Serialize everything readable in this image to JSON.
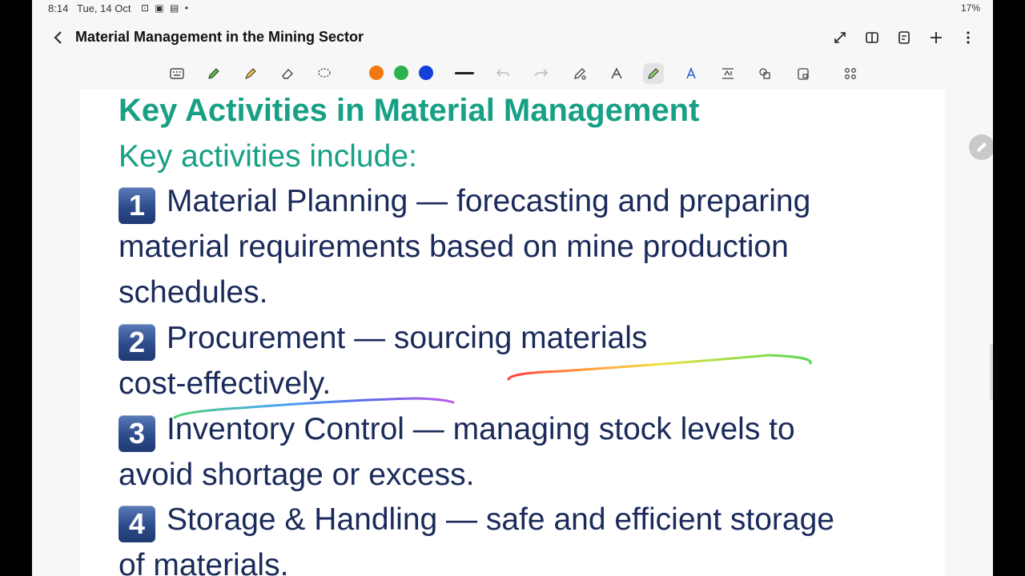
{
  "status_bar": {
    "time": "8:14",
    "date": "Tue, 14 Oct",
    "icons_text": "⊡ ▣ ▤ •",
    "battery": "17%"
  },
  "title_bar": {
    "title": "Material Management in the Mining Sector",
    "actions": [
      "expand-icon",
      "split-view-icon",
      "pages-icon",
      "add-icon",
      "more-icon"
    ]
  },
  "toolbar": {
    "tools": [
      "keyboard-icon",
      "pen-icon",
      "highlighter-icon",
      "eraser-icon",
      "lasso-icon"
    ],
    "colors": [
      "#f07a10",
      "#2bb24c",
      "#1240d8"
    ],
    "right_tools": [
      "undo-icon",
      "redo-icon",
      "pen-settings-icon",
      "shape-pen-icon",
      "rainbow-pen-icon",
      "text-style-icon",
      "text-recognition-icon",
      "shapes-icon",
      "lock-icon",
      "apps-icon"
    ],
    "active_tool": "rainbow-pen-icon"
  },
  "note": {
    "heading": "Key Activities in Material Management",
    "subheading": "Key activities include:",
    "items": [
      {
        "num": "1",
        "lines": [
          "Material Planning — forecasting and preparing",
          "material requirements based on mine production",
          "schedules."
        ]
      },
      {
        "num": "2",
        "lines": [
          "Procurement — sourcing materials",
          "cost-effectively."
        ]
      },
      {
        "num": "3",
        "lines": [
          "Inventory Control — managing stock levels to",
          "avoid shortage or excess."
        ]
      },
      {
        "num": "4",
        "lines": [
          "Storage & Handling — safe and efficient storage",
          "of materials."
        ]
      }
    ]
  }
}
